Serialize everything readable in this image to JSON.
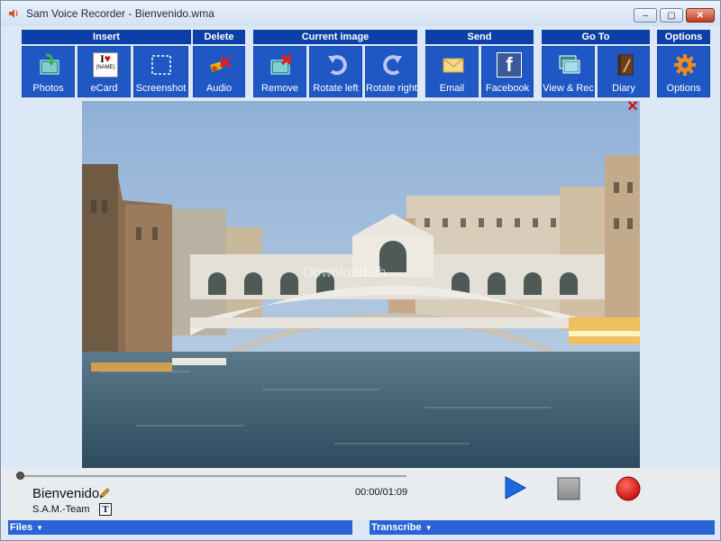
{
  "window": {
    "title": "Sam Voice Recorder - Bienvenido.wma",
    "controls": {
      "minimize": "–",
      "maximize": "▢",
      "close": "✕"
    }
  },
  "toolbar": {
    "groups": [
      {
        "title": "Insert",
        "buttons": [
          {
            "label": "Photos",
            "icon": "photos-icon"
          },
          {
            "label": "eCard",
            "icon": "ecard-icon",
            "icon_text": "I",
            "icon_subtext": "(NAME)"
          },
          {
            "label": "Screenshot",
            "icon": "screenshot-icon"
          }
        ]
      },
      {
        "title": "Delete",
        "buttons": [
          {
            "label": "Audio",
            "icon": "delete-audio-icon"
          }
        ]
      },
      {
        "title": "Current image",
        "buttons": [
          {
            "label": "Remove",
            "icon": "remove-image-icon"
          },
          {
            "label": "Rotate left",
            "icon": "rotate-left-icon"
          },
          {
            "label": "Rotate right",
            "icon": "rotate-right-icon"
          }
        ]
      },
      {
        "title": "Send",
        "buttons": [
          {
            "label": "Email",
            "icon": "email-icon"
          },
          {
            "label": "Facebook",
            "icon": "facebook-icon",
            "icon_text": "f"
          }
        ]
      },
      {
        "title": "Go To",
        "buttons": [
          {
            "label": "View & Rec",
            "icon": "view-rec-icon"
          },
          {
            "label": "Diary",
            "icon": "diary-icon"
          }
        ]
      },
      {
        "title": "Options",
        "buttons": [
          {
            "label": "Options",
            "icon": "gear-icon"
          }
        ]
      }
    ]
  },
  "image": {
    "close_symbol": "✕",
    "watermark": "Download.ch"
  },
  "player": {
    "track_title": "Bienvenido",
    "author": "S.A.M.-Team",
    "time": "00:00/01:09",
    "progress": 0.0,
    "text_icon_glyph": "T"
  },
  "bottom": {
    "files_label": "Files",
    "transcribe_label": "Transcribe",
    "caret": "▼"
  },
  "colors": {
    "toolbar_header": "#0d3fa8",
    "toolbar_button": "#1f57c4",
    "bottom_bar": "#2a63d6",
    "record_red": "#d21616",
    "play_blue": "#1a6be0"
  }
}
